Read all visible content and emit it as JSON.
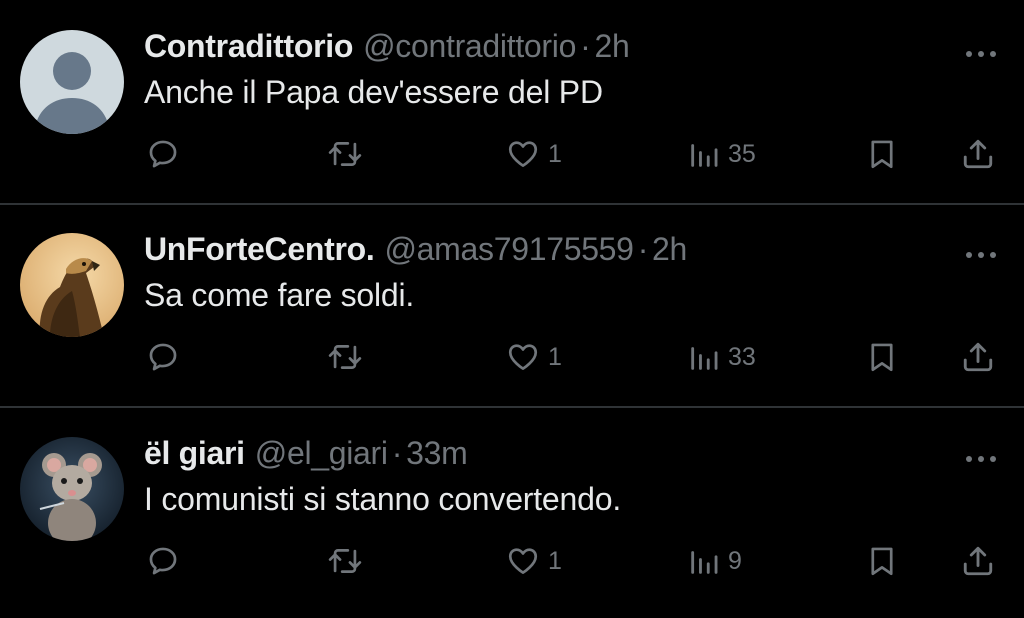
{
  "tweets": [
    {
      "name": "Contradittorio",
      "handle": "@contradittorio",
      "separator": "·",
      "time": "2h",
      "text": "Anche il Papa dev'essere del PD",
      "likes": "1",
      "views": "35",
      "avatar": "default-profile-avatar"
    },
    {
      "name": "UnForteCentro.",
      "handle": "@amas79175559",
      "separator": "·",
      "time": "2h",
      "text": "Sa come fare soldi.",
      "likes": "1",
      "views": "33",
      "avatar": "eagle-avatar"
    },
    {
      "name": "ël giari",
      "handle": "@el_giari",
      "separator": "·",
      "time": "33m",
      "text": "I comunisti si stanno convertendo.",
      "likes": "1",
      "views": "9",
      "avatar": "mouse-avatar"
    }
  ],
  "icons": {
    "reply": "reply-icon",
    "retweet": "retweet-icon",
    "like": "heart-icon",
    "views": "views-chart-icon",
    "bookmark": "bookmark-icon",
    "share": "share-icon",
    "more": "more-dots-icon"
  },
  "colors": {
    "background": "#000000",
    "primary_text": "#e7e9ea",
    "secondary_text": "#71767b",
    "divider": "#2f3336"
  }
}
